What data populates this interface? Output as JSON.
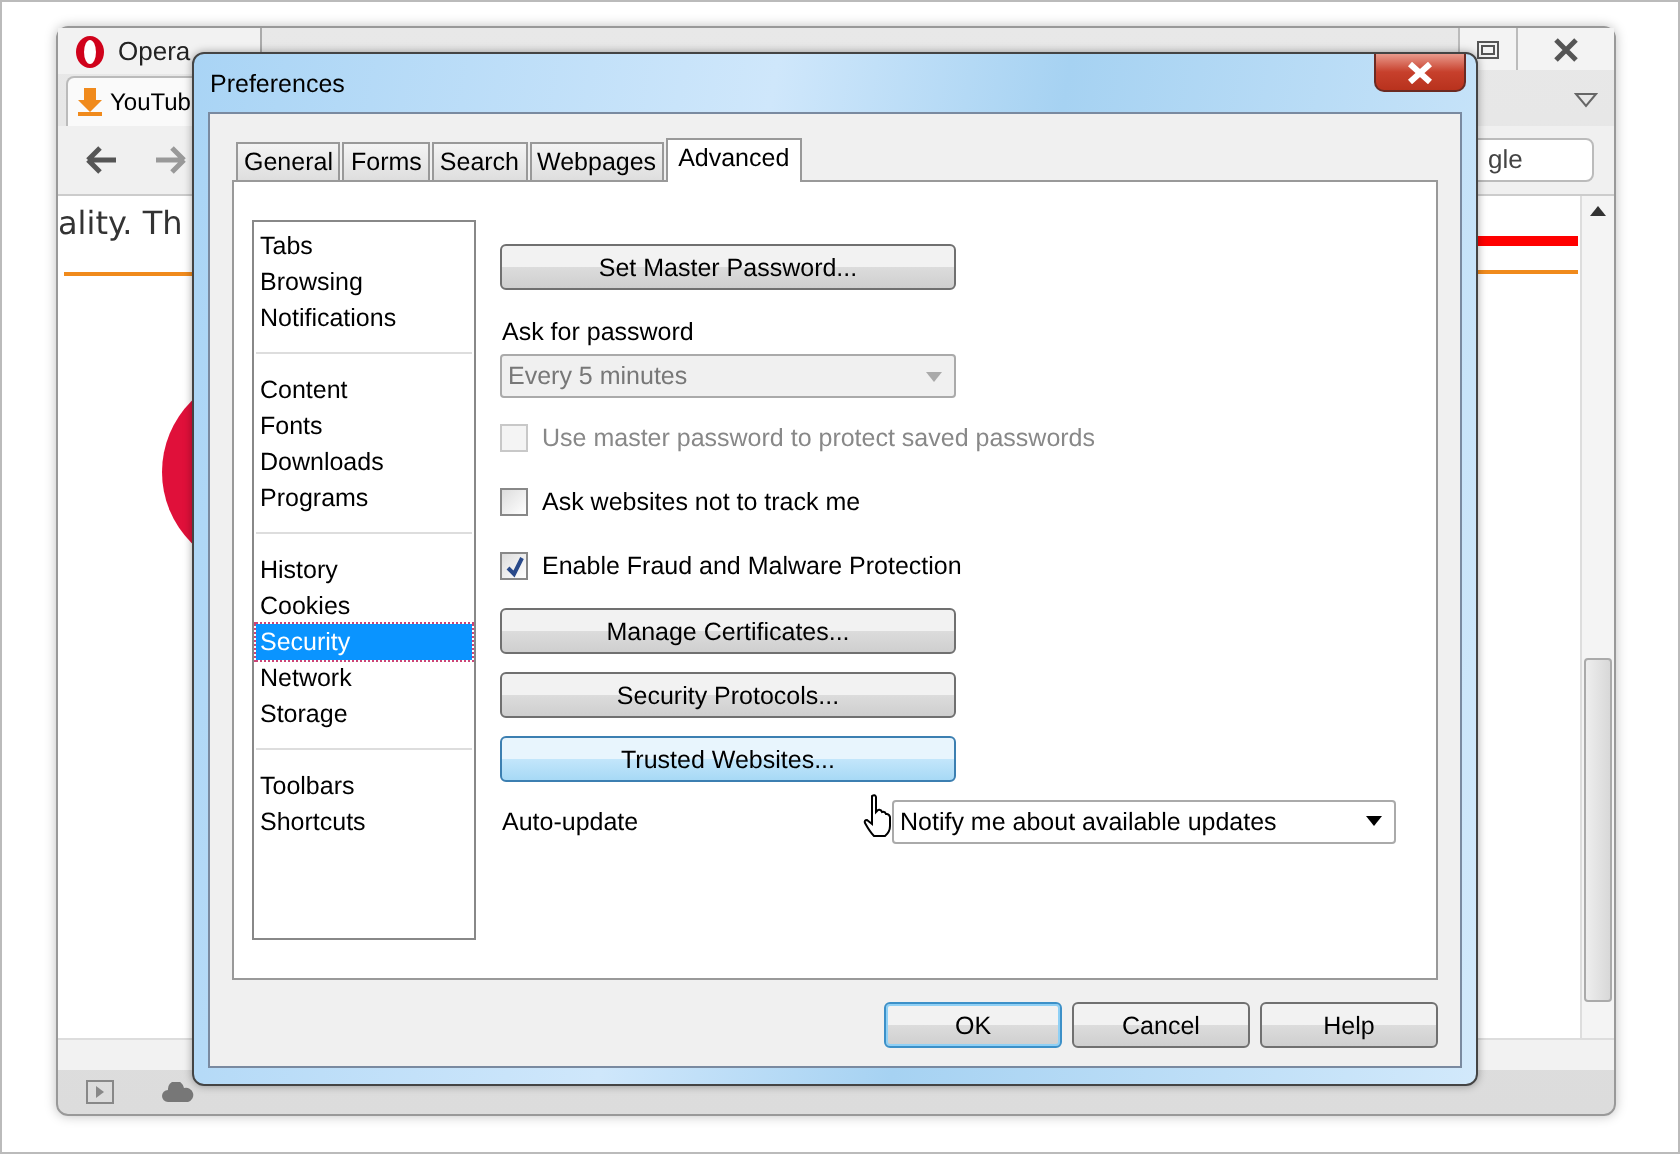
{
  "browser": {
    "title": "Opera",
    "tab": "YouTub",
    "search_value": "gle",
    "page_text": "ality. Th"
  },
  "dialog": {
    "title": "Preferences",
    "tabs": [
      {
        "label": "General",
        "selected": false
      },
      {
        "label": "Forms",
        "selected": false
      },
      {
        "label": "Search",
        "selected": false
      },
      {
        "label": "Webpages",
        "selected": false
      },
      {
        "label": "Advanced",
        "selected": true
      }
    ],
    "sidebar": [
      [
        {
          "label": "Tabs",
          "selected": false
        },
        {
          "label": "Browsing",
          "selected": false
        },
        {
          "label": "Notifications",
          "selected": false
        }
      ],
      [
        {
          "label": "Content",
          "selected": false
        },
        {
          "label": "Fonts",
          "selected": false
        },
        {
          "label": "Downloads",
          "selected": false
        },
        {
          "label": "Programs",
          "selected": false
        }
      ],
      [
        {
          "label": "History",
          "selected": false
        },
        {
          "label": "Cookies",
          "selected": false
        },
        {
          "label": "Security",
          "selected": true
        },
        {
          "label": "Network",
          "selected": false
        },
        {
          "label": "Storage",
          "selected": false
        }
      ],
      [
        {
          "label": "Toolbars",
          "selected": false
        },
        {
          "label": "Shortcuts",
          "selected": false
        }
      ]
    ],
    "settings": [
      {
        "kind": "button",
        "label": "Set Master Password...",
        "hovered": false
      },
      {
        "kind": "label",
        "label": "Ask for password"
      },
      {
        "kind": "select",
        "value": "Every 5 minutes",
        "disabled": true
      },
      {
        "kind": "checkbox",
        "label": "Use master password to protect saved passwords",
        "checked": false,
        "disabled": true
      },
      {
        "kind": "checkbox",
        "label": "Ask websites not to track me",
        "checked": false,
        "disabled": false
      },
      {
        "kind": "checkbox",
        "label": "Enable Fraud and Malware Protection",
        "checked": true,
        "disabled": false
      },
      {
        "kind": "button",
        "label": "Manage Certificates...",
        "hovered": false
      },
      {
        "kind": "button",
        "label": "Security Protocols...",
        "hovered": false
      },
      {
        "kind": "button",
        "label": "Trusted Websites...",
        "hovered": true
      },
      {
        "kind": "labeled_select",
        "label": "Auto-update",
        "value": "Notify me about available updates",
        "disabled": false
      }
    ],
    "buttons": [
      {
        "label": "OK",
        "default": true
      },
      {
        "label": "Cancel",
        "default": false
      },
      {
        "label": "Help",
        "default": false
      }
    ]
  }
}
